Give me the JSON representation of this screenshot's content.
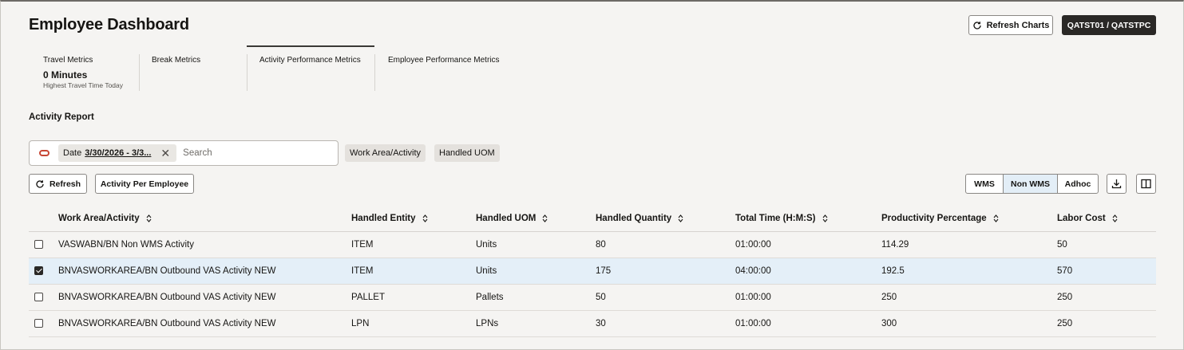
{
  "header": {
    "title": "Employee Dashboard",
    "refresh_charts_label": "Refresh Charts",
    "user_label": "QATST01 / QATSTPC"
  },
  "tabs": [
    {
      "label": "Travel Metrics",
      "value": "0 Minutes",
      "sub": "Highest Travel Time Today"
    },
    {
      "label": "Break Metrics"
    },
    {
      "label": "Activity Performance Metrics",
      "active": true
    },
    {
      "label": "Employee Performance Metrics"
    }
  ],
  "report": {
    "title": "Activity Report",
    "filter": {
      "chip_prefix": "Date",
      "chip_value": "3/30/2026 - 3/3...",
      "search_placeholder": "Search"
    },
    "pills": [
      "Work Area/Activity",
      "Handled UOM"
    ],
    "buttons": {
      "refresh": "Refresh",
      "activity_per_employee": "Activity Per Employee"
    },
    "segments": [
      "WMS",
      "Non WMS",
      "Adhoc"
    ],
    "active_segment": "Non WMS"
  },
  "table": {
    "columns": [
      "Work Area/Activity",
      "Handled Entity",
      "Handled UOM",
      "Handled Quantity",
      "Total Time (H:M:S)",
      "Productivity Percentage",
      "Labor Cost"
    ],
    "rows": [
      {
        "checked": false,
        "cells": [
          "VASWABN/BN Non WMS Activity",
          "ITEM",
          "Units",
          "80",
          "01:00:00",
          "114.29",
          "50"
        ]
      },
      {
        "checked": true,
        "cells": [
          "BNVASWORKAREA/BN Outbound VAS Activity NEW",
          "ITEM",
          "Units",
          "175",
          "04:00:00",
          "192.5",
          "570"
        ]
      },
      {
        "checked": false,
        "cells": [
          "BNVASWORKAREA/BN Outbound VAS Activity NEW",
          "PALLET",
          "Pallets",
          "50",
          "01:00:00",
          "250",
          "250"
        ]
      },
      {
        "checked": false,
        "cells": [
          "BNVASWORKAREA/BN Outbound VAS Activity NEW",
          "LPN",
          "LPNs",
          "30",
          "01:00:00",
          "300",
          "250"
        ]
      }
    ]
  },
  "colors": {
    "accent_red": "#c74634",
    "selected_row": "#e4eff8",
    "dark_button": "#2a2826"
  }
}
